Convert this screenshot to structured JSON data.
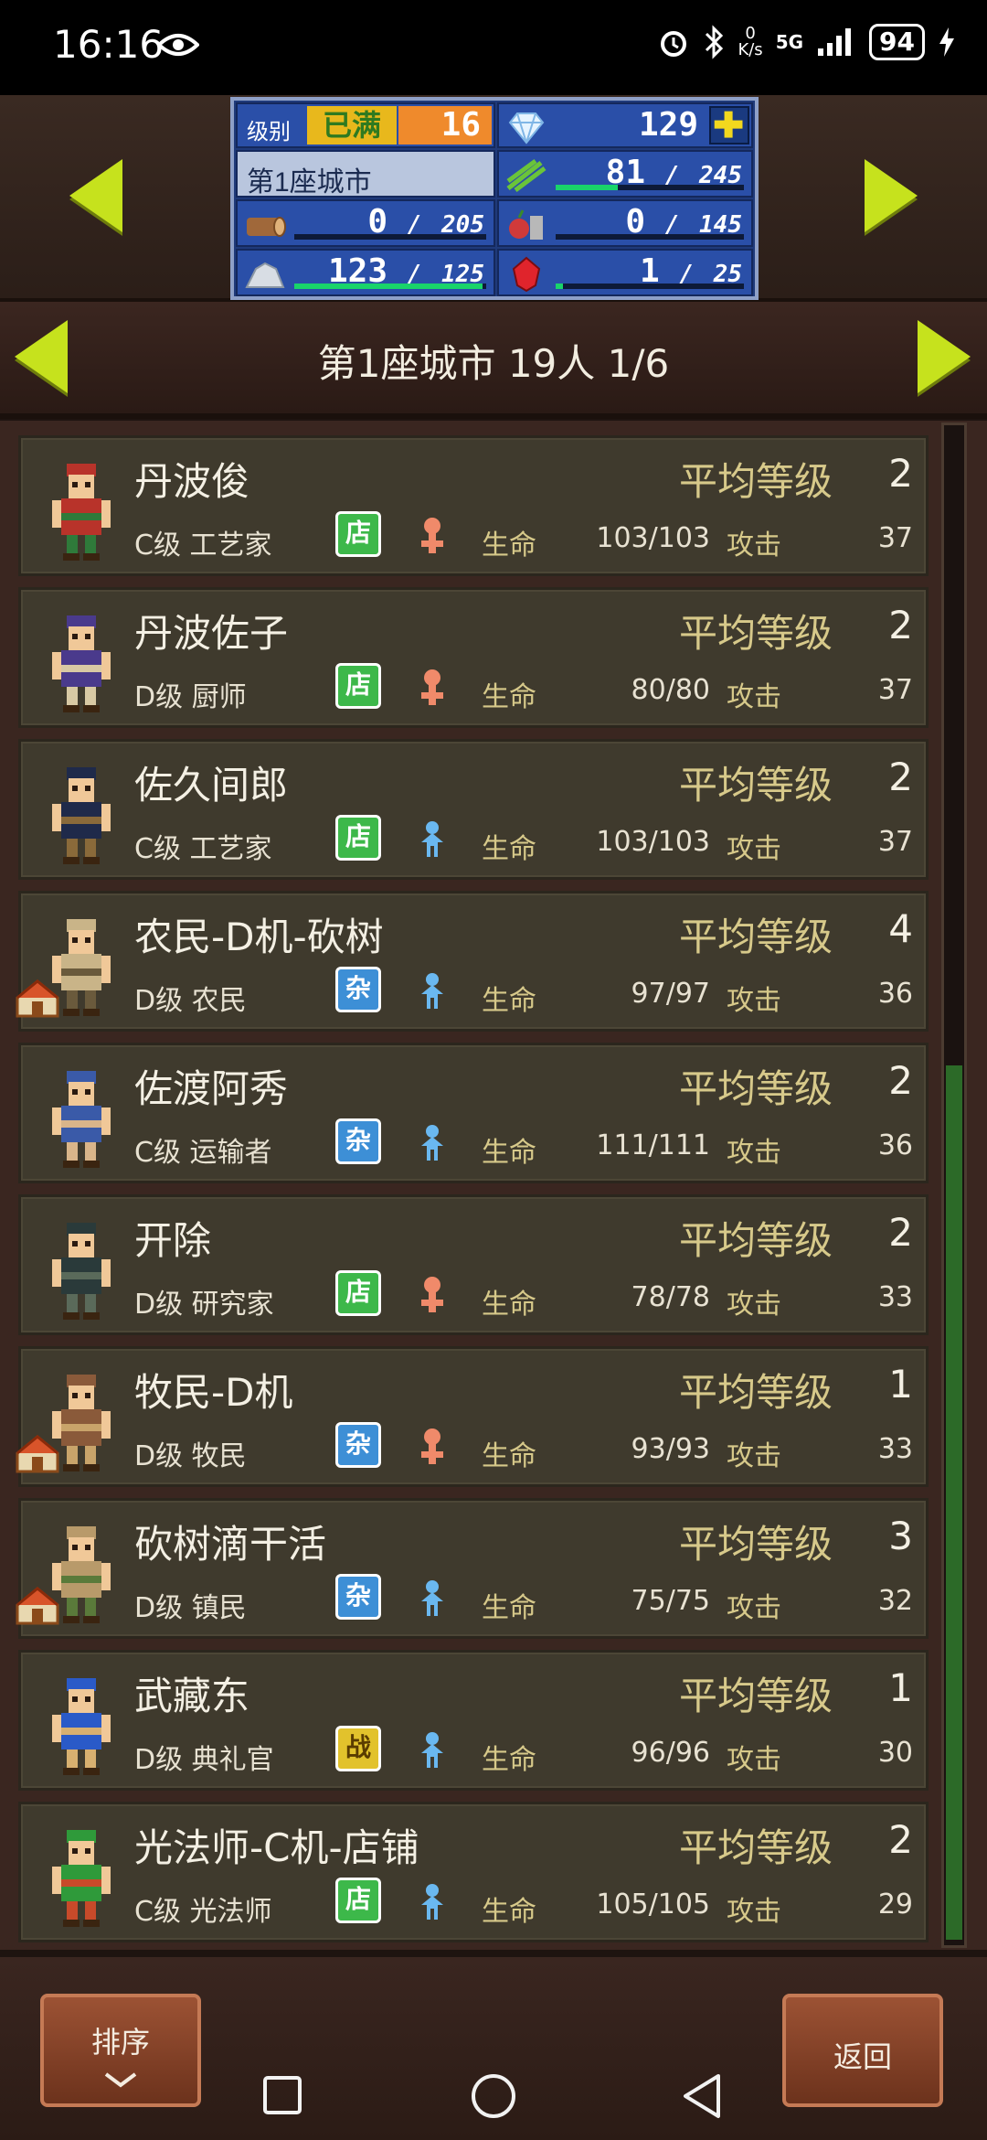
{
  "status": {
    "time": "16:16",
    "net_speed": "0",
    "net_unit": "K/s",
    "signal": "5G",
    "battery": "94"
  },
  "resources": {
    "level_label": "级别",
    "level_full": "已满",
    "level_value": "16",
    "gems": "129",
    "city_name_short": "第1座城市",
    "food_current": "81",
    "food_max": "245",
    "wood_current": "0",
    "wood_max": "205",
    "crop_current": "0",
    "crop_max": "145",
    "ore_current": "123",
    "ore_max": "125",
    "ruby_current": "1",
    "ruby_max": "25",
    "bar_fill": {
      "food": 0.33,
      "wood": 0.0,
      "crop": 0.0,
      "ore": 0.98,
      "ruby": 0.04
    },
    "sep": "/"
  },
  "city_header": {
    "title": "第1座城市  19人 1/6"
  },
  "residents": [
    {
      "name": "丹波俊",
      "avg_label": "平均等级",
      "avg_level": "2",
      "class": "C级 工艺家",
      "badge": "店",
      "badge_type": "store",
      "gender": "female",
      "hp_label": "生命",
      "hp": "103/103",
      "atk_label": "攻击",
      "atk": "37",
      "colors": [
        "#b8332a",
        "#2f7a3a"
      ],
      "home": false
    },
    {
      "name": "丹波佐子",
      "avg_label": "平均等级",
      "avg_level": "2",
      "class": "D级 厨师",
      "badge": "店",
      "badge_type": "store",
      "gender": "female",
      "hp_label": "生命",
      "hp": "80/80",
      "atk_label": "攻击",
      "atk": "37",
      "colors": [
        "#4a3a8c",
        "#d8c9a4"
      ],
      "home": false
    },
    {
      "name": "佐久间郎",
      "avg_label": "平均等级",
      "avg_level": "2",
      "class": "C级 工艺家",
      "badge": "店",
      "badge_type": "store",
      "gender": "male",
      "hp_label": "生命",
      "hp": "103/103",
      "atk_label": "攻击",
      "atk": "37",
      "colors": [
        "#1f2a4a",
        "#8a6a3a"
      ],
      "home": false
    },
    {
      "name": "农民-D机-砍树",
      "avg_label": "平均等级",
      "avg_level": "4",
      "class": "D级 农民",
      "badge": "杂",
      "badge_type": "misc",
      "gender": "male",
      "hp_label": "生命",
      "hp": "97/97",
      "atk_label": "攻击",
      "atk": "36",
      "colors": [
        "#c9b488",
        "#6a5a3c"
      ],
      "home": true
    },
    {
      "name": "佐渡阿秀",
      "avg_label": "平均等级",
      "avg_level": "2",
      "class": "C级 运输者",
      "badge": "杂",
      "badge_type": "misc",
      "gender": "male",
      "hp_label": "生命",
      "hp": "111/111",
      "atk_label": "攻击",
      "atk": "36",
      "colors": [
        "#3a5aa8",
        "#d9b58a"
      ],
      "home": false
    },
    {
      "name": "开除",
      "avg_label": "平均等级",
      "avg_level": "2",
      "class": "D级 研究家",
      "badge": "店",
      "badge_type": "store",
      "gender": "female",
      "hp_label": "生命",
      "hp": "78/78",
      "atk_label": "攻击",
      "atk": "33",
      "colors": [
        "#2a3a3a",
        "#5a6a5a"
      ],
      "home": false
    },
    {
      "name": "牧民-D机",
      "avg_label": "平均等级",
      "avg_level": "1",
      "class": "D级 牧民",
      "badge": "杂",
      "badge_type": "misc",
      "gender": "female",
      "hp_label": "生命",
      "hp": "93/93",
      "atk_label": "攻击",
      "atk": "33",
      "colors": [
        "#8a5a3a",
        "#c9a46a"
      ],
      "home": true
    },
    {
      "name": "砍树滴干活",
      "avg_label": "平均等级",
      "avg_level": "3",
      "class": "D级 镇民",
      "badge": "杂",
      "badge_type": "misc",
      "gender": "male",
      "hp_label": "生命",
      "hp": "75/75",
      "atk_label": "攻击",
      "atk": "32",
      "colors": [
        "#b89a6a",
        "#5a7a3a"
      ],
      "home": true
    },
    {
      "name": "武藏东",
      "avg_label": "平均等级",
      "avg_level": "1",
      "class": "D级 典礼官",
      "badge": "战",
      "badge_type": "war",
      "gender": "male",
      "hp_label": "生命",
      "hp": "96/96",
      "atk_label": "攻击",
      "atk": "30",
      "colors": [
        "#2a5ac8",
        "#d8b070"
      ],
      "home": false
    },
    {
      "name": "光法师-C机-店铺",
      "avg_label": "平均等级",
      "avg_level": "2",
      "class": "C级 光法师",
      "badge": "店",
      "badge_type": "store",
      "gender": "male",
      "hp_label": "生命",
      "hp": "105/105",
      "atk_label": "攻击",
      "atk": "29",
      "colors": [
        "#2f9a3a",
        "#c84a2a"
      ],
      "home": false
    }
  ],
  "buttons": {
    "sort": "排序",
    "back": "返回"
  },
  "icons": [
    "eye-icon",
    "alarm-icon",
    "bluetooth-icon",
    "signal-icon",
    "battery-icon",
    "charging-icon",
    "gem-icon",
    "plus-icon",
    "wheat-icon",
    "log-icon",
    "fruit-icon",
    "stone-icon",
    "ruby-icon",
    "female-icon",
    "male-icon",
    "house-icon",
    "square-nav-icon",
    "circle-nav-icon",
    "back-nav-icon"
  ],
  "colors": {
    "accent": "#c6e21d",
    "panel_blue": "#2a4fa8",
    "row_bg": "#3f3a2d",
    "gold_text": "#d7c98a",
    "button_brown": "#8a4329"
  }
}
